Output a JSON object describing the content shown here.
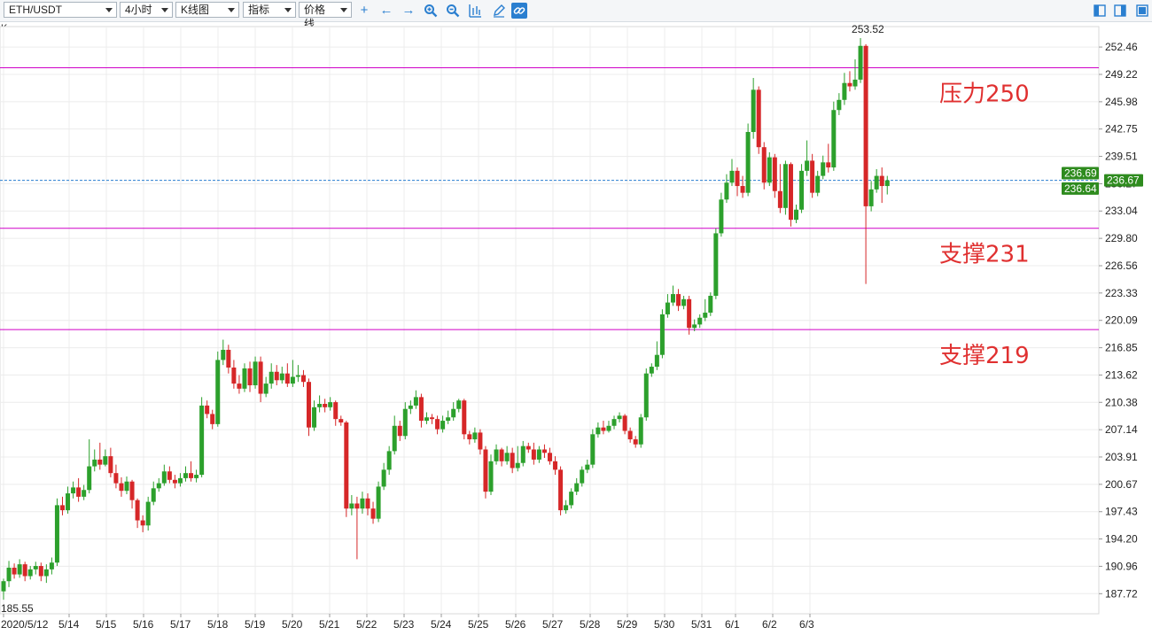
{
  "toolbar": {
    "symbol": "ETH/USDT",
    "interval": "4小时",
    "chart_style": "K线图",
    "indicators": "指标",
    "price_line": "价格线"
  },
  "panel_label": "K",
  "colors": {
    "up": "#2ca02c",
    "down": "#d62728",
    "level_line": "#d000c8",
    "price_line": "#2a7fd0",
    "grid": "#ececec"
  },
  "annotations": [
    {
      "text": "压力250",
      "value": 250
    },
    {
      "text": "支撑231",
      "value": 231
    },
    {
      "text": "支撑219",
      "value": 219
    }
  ],
  "price_tags": [
    {
      "text": "236.69",
      "value": 236.69,
      "style": "green"
    },
    {
      "text": "236.67",
      "value": 236.67,
      "style": "green-axis"
    },
    {
      "text": "236.64",
      "value": 236.64,
      "style": "green"
    }
  ],
  "chart_data": {
    "type": "candlestick",
    "ylim": [
      185.55,
      253.52
    ],
    "y_ticks": [
      "252.46",
      "249.22",
      "245.98",
      "242.75",
      "239.51",
      "236.27",
      "233.04",
      "229.80",
      "226.56",
      "223.33",
      "220.09",
      "216.85",
      "213.62",
      "210.38",
      "207.14",
      "203.91",
      "200.67",
      "197.43",
      "194.20",
      "190.96",
      "187.72"
    ],
    "x_ticks": [
      "2020/5/12",
      "5/14",
      "5/15",
      "5/16",
      "5/17",
      "5/18",
      "5/19",
      "5/20",
      "5/21",
      "5/22",
      "5/23",
      "5/24",
      "5/25",
      "5/26",
      "5/27",
      "5/28",
      "5/29",
      "5/30",
      "5/31",
      "6/1",
      "6/2",
      "6/3"
    ],
    "high_label": "253.52",
    "low_label": "185.55",
    "last_price": 236.67,
    "candles": [
      [
        188.0,
        189.2,
        187.0,
        189.5
      ],
      [
        189.2,
        190.8,
        188.5,
        191.6
      ],
      [
        190.8,
        190.0,
        189.5,
        191.3
      ],
      [
        190.0,
        191.2,
        189.6,
        191.8
      ],
      [
        191.2,
        189.8,
        189.2,
        191.5
      ],
      [
        189.8,
        190.6,
        189.4,
        191.0
      ],
      [
        190.6,
        191.0,
        190.0,
        191.5
      ],
      [
        191.0,
        189.8,
        189.2,
        191.4
      ],
      [
        189.8,
        190.6,
        189.0,
        191.2
      ],
      [
        190.6,
        191.4,
        190.0,
        192.0
      ],
      [
        191.4,
        198.2,
        191.0,
        199.0
      ],
      [
        198.2,
        197.6,
        197.0,
        199.2
      ],
      [
        197.6,
        199.6,
        197.2,
        200.4
      ],
      [
        199.6,
        200.3,
        199.0,
        201.0
      ],
      [
        200.3,
        199.2,
        198.6,
        201.4
      ],
      [
        199.2,
        200.0,
        198.8,
        200.6
      ],
      [
        200.0,
        202.8,
        199.6,
        206.0
      ],
      [
        202.8,
        203.6,
        202.2,
        204.8
      ],
      [
        203.6,
        203.0,
        202.4,
        205.6
      ],
      [
        203.0,
        204.0,
        202.8,
        204.8
      ],
      [
        204.0,
        202.0,
        201.5,
        205.0
      ],
      [
        202.0,
        200.8,
        200.2,
        203.0
      ],
      [
        200.8,
        199.9,
        199.2,
        201.5
      ],
      [
        199.9,
        201.0,
        199.5,
        201.6
      ],
      [
        201.0,
        198.8,
        197.8,
        201.2
      ],
      [
        198.8,
        196.4,
        195.5,
        199.0
      ],
      [
        196.4,
        195.8,
        195.0,
        197.0
      ],
      [
        195.8,
        198.6,
        195.2,
        199.2
      ],
      [
        198.6,
        200.2,
        198.2,
        201.0
      ],
      [
        200.2,
        200.8,
        199.8,
        201.4
      ],
      [
        200.8,
        202.2,
        200.5,
        203.0
      ],
      [
        202.2,
        201.2,
        200.8,
        202.8
      ],
      [
        201.2,
        200.8,
        200.2,
        201.8
      ],
      [
        200.8,
        201.4,
        200.4,
        202.0
      ],
      [
        201.4,
        202.0,
        201.0,
        202.8
      ],
      [
        202.0,
        201.4,
        201.0,
        203.4
      ],
      [
        201.4,
        201.8,
        200.9,
        202.4
      ],
      [
        201.8,
        210.0,
        201.5,
        211.0
      ],
      [
        210.0,
        209.0,
        208.5,
        210.6
      ],
      [
        209.0,
        207.8,
        207.2,
        209.5
      ],
      [
        207.8,
        215.4,
        207.5,
        216.4
      ],
      [
        215.4,
        216.6,
        214.8,
        217.8
      ],
      [
        216.6,
        214.5,
        213.8,
        217.2
      ],
      [
        214.5,
        212.6,
        212.0,
        215.4
      ],
      [
        212.6,
        212.0,
        211.4,
        213.6
      ],
      [
        212.0,
        214.4,
        211.6,
        215.0
      ],
      [
        214.4,
        212.4,
        211.6,
        215.2
      ],
      [
        212.4,
        215.2,
        212.0,
        215.8
      ],
      [
        215.2,
        211.4,
        210.4,
        215.8
      ],
      [
        211.4,
        212.6,
        211.0,
        213.4
      ],
      [
        212.6,
        214.0,
        212.0,
        215.0
      ],
      [
        214.0,
        213.0,
        212.4,
        214.8
      ],
      [
        213.0,
        213.8,
        212.6,
        214.6
      ],
      [
        213.8,
        212.6,
        212.2,
        215.0
      ],
      [
        212.6,
        213.4,
        212.2,
        215.4
      ],
      [
        213.4,
        213.6,
        212.8,
        214.8
      ],
      [
        213.6,
        212.8,
        212.2,
        214.2
      ],
      [
        212.8,
        207.4,
        206.4,
        213.2
      ],
      [
        207.4,
        209.8,
        207.0,
        210.6
      ],
      [
        209.8,
        210.2,
        209.2,
        211.2
      ],
      [
        210.2,
        209.8,
        209.2,
        210.8
      ],
      [
        209.8,
        210.4,
        209.4,
        211.0
      ],
      [
        210.4,
        208.4,
        207.6,
        210.6
      ],
      [
        208.4,
        208.0,
        207.6,
        208.8
      ],
      [
        208.0,
        197.8,
        196.8,
        208.2
      ],
      [
        197.8,
        198.4,
        197.0,
        199.4
      ],
      [
        198.4,
        197.8,
        191.8,
        199.2
      ],
      [
        197.8,
        199.0,
        197.2,
        199.8
      ],
      [
        199.0,
        197.8,
        197.0,
        199.6
      ],
      [
        197.8,
        196.6,
        196.0,
        198.6
      ],
      [
        196.6,
        200.4,
        196.2,
        201.0
      ],
      [
        200.4,
        202.4,
        200.0,
        203.2
      ],
      [
        202.4,
        204.6,
        201.8,
        205.2
      ],
      [
        204.6,
        207.6,
        204.2,
        208.8
      ],
      [
        207.6,
        206.4,
        205.8,
        208.2
      ],
      [
        206.4,
        209.6,
        206.0,
        210.4
      ],
      [
        209.6,
        210.0,
        209.0,
        210.6
      ],
      [
        210.0,
        211.0,
        209.6,
        211.8
      ],
      [
        211.0,
        208.2,
        207.4,
        211.4
      ],
      [
        208.2,
        208.6,
        207.8,
        209.2
      ],
      [
        208.6,
        208.4,
        207.8,
        209.0
      ],
      [
        208.4,
        207.2,
        206.6,
        208.8
      ],
      [
        207.2,
        208.2,
        206.8,
        208.8
      ],
      [
        208.2,
        208.6,
        207.8,
        209.4
      ],
      [
        208.6,
        209.6,
        208.2,
        210.4
      ],
      [
        209.6,
        210.6,
        209.2,
        210.8
      ],
      [
        210.6,
        206.6,
        206.0,
        210.8
      ],
      [
        206.6,
        206.0,
        205.4,
        207.0
      ],
      [
        206.0,
        206.8,
        205.6,
        207.4
      ],
      [
        206.8,
        204.8,
        204.2,
        207.2
      ],
      [
        204.8,
        199.8,
        199.0,
        205.2
      ],
      [
        199.8,
        203.4,
        199.4,
        204.2
      ],
      [
        203.4,
        204.8,
        203.0,
        205.4
      ],
      [
        204.8,
        203.4,
        202.8,
        205.0
      ],
      [
        203.4,
        204.4,
        203.0,
        205.2
      ],
      [
        204.4,
        202.6,
        202.0,
        205.0
      ],
      [
        202.6,
        203.2,
        202.2,
        205.2
      ],
      [
        203.2,
        205.2,
        202.8,
        205.8
      ],
      [
        205.2,
        204.8,
        204.4,
        205.6
      ],
      [
        204.8,
        203.6,
        203.0,
        205.6
      ],
      [
        203.6,
        204.8,
        203.2,
        205.2
      ],
      [
        204.8,
        204.4,
        203.8,
        205.4
      ],
      [
        204.4,
        203.4,
        203.0,
        205.0
      ],
      [
        203.4,
        202.4,
        201.8,
        204.0
      ],
      [
        202.4,
        197.6,
        197.0,
        202.8
      ],
      [
        197.6,
        198.2,
        197.2,
        198.8
      ],
      [
        198.2,
        199.8,
        197.8,
        200.2
      ],
      [
        199.8,
        200.8,
        199.4,
        201.4
      ],
      [
        200.8,
        202.4,
        200.4,
        202.8
      ],
      [
        202.4,
        203.0,
        202.0,
        203.6
      ],
      [
        203.0,
        206.6,
        202.6,
        207.2
      ],
      [
        206.6,
        207.4,
        206.2,
        208.0
      ],
      [
        207.4,
        207.0,
        206.6,
        208.2
      ],
      [
        207.0,
        207.6,
        206.8,
        208.2
      ],
      [
        207.6,
        208.4,
        207.2,
        208.8
      ],
      [
        208.4,
        208.8,
        208.0,
        209.2
      ],
      [
        208.8,
        207.0,
        206.6,
        209.0
      ],
      [
        207.0,
        206.0,
        205.6,
        207.4
      ],
      [
        206.0,
        205.4,
        205.0,
        206.4
      ],
      [
        205.4,
        208.6,
        205.0,
        209.0
      ],
      [
        208.6,
        213.8,
        208.2,
        214.4
      ],
      [
        213.8,
        214.6,
        213.4,
        215.0
      ],
      [
        214.6,
        216.0,
        214.2,
        217.6
      ],
      [
        216.0,
        220.8,
        215.6,
        221.4
      ],
      [
        220.8,
        222.2,
        220.4,
        223.2
      ],
      [
        222.2,
        223.2,
        221.8,
        224.2
      ],
      [
        223.2,
        221.8,
        221.2,
        223.8
      ],
      [
        221.8,
        222.6,
        221.4,
        223.0
      ],
      [
        222.6,
        219.2,
        218.4,
        223.0
      ],
      [
        219.2,
        219.6,
        218.8,
        220.2
      ],
      [
        219.6,
        220.4,
        219.2,
        220.8
      ],
      [
        220.4,
        221.0,
        220.0,
        222.6
      ],
      [
        221.0,
        223.0,
        220.6,
        223.4
      ],
      [
        223.0,
        230.4,
        222.6,
        231.0
      ],
      [
        230.4,
        234.4,
        230.0,
        235.2
      ],
      [
        234.4,
        236.4,
        234.0,
        237.4
      ],
      [
        236.4,
        237.8,
        236.0,
        239.2
      ],
      [
        237.8,
        236.0,
        234.8,
        238.2
      ],
      [
        236.0,
        235.2,
        234.6,
        237.2
      ],
      [
        235.2,
        242.4,
        234.8,
        243.4
      ],
      [
        242.4,
        247.4,
        241.6,
        248.8
      ],
      [
        247.4,
        240.6,
        239.8,
        247.8
      ],
      [
        240.6,
        236.4,
        235.6,
        241.2
      ],
      [
        236.4,
        239.4,
        236.0,
        240.0
      ],
      [
        239.4,
        235.4,
        234.6,
        239.8
      ],
      [
        235.4,
        233.4,
        232.8,
        238.6
      ],
      [
        233.4,
        238.6,
        232.6,
        239.0
      ],
      [
        238.6,
        232.0,
        231.2,
        238.8
      ],
      [
        232.0,
        233.2,
        231.6,
        233.8
      ],
      [
        233.2,
        237.8,
        232.8,
        238.6
      ],
      [
        237.8,
        239.0,
        237.2,
        241.4
      ],
      [
        239.0,
        235.2,
        234.6,
        239.8
      ],
      [
        235.2,
        237.2,
        234.8,
        237.8
      ],
      [
        237.2,
        238.8,
        236.8,
        239.6
      ],
      [
        238.8,
        238.2,
        237.6,
        241.0
      ],
      [
        238.2,
        245.0,
        237.8,
        246.0
      ],
      [
        245.0,
        246.2,
        244.4,
        247.0
      ],
      [
        246.2,
        248.2,
        245.6,
        249.4
      ],
      [
        248.2,
        247.8,
        247.2,
        249.6
      ],
      [
        247.8,
        248.6,
        247.4,
        251.0
      ],
      [
        248.6,
        252.6,
        248.2,
        253.52
      ],
      [
        252.6,
        233.6,
        224.4,
        252.8
      ],
      [
        233.6,
        235.6,
        233.0,
        236.6
      ],
      [
        235.6,
        237.2,
        235.2,
        238.0
      ],
      [
        237.2,
        236.0,
        234.0,
        238.2
      ],
      [
        236.0,
        236.67,
        235.0,
        237.2
      ]
    ]
  }
}
